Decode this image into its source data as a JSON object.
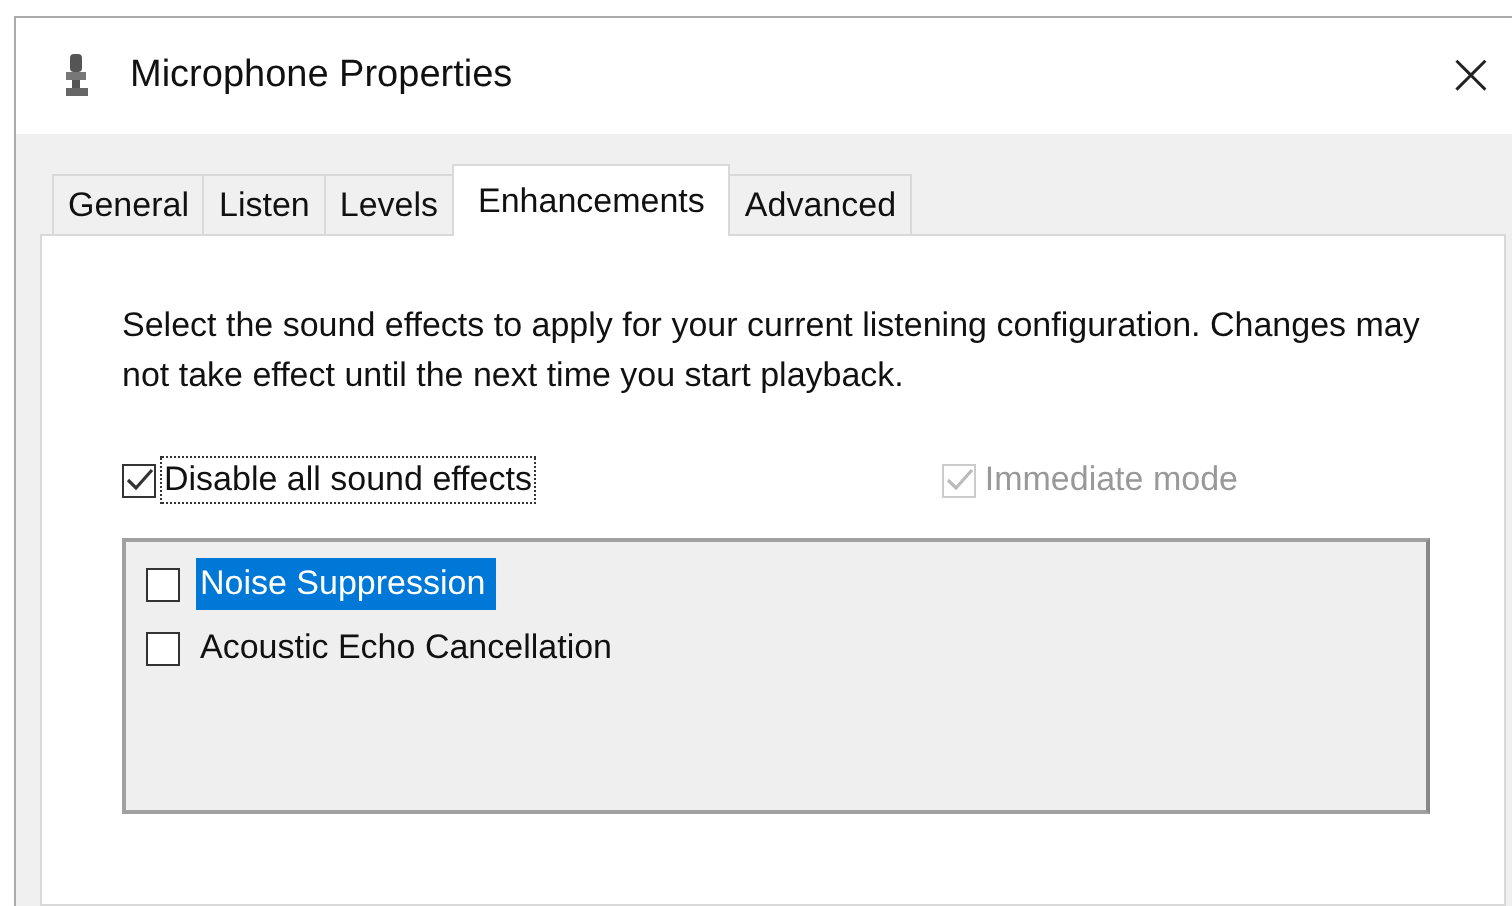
{
  "window": {
    "title": "Microphone Properties",
    "close": "×"
  },
  "tabs": [
    {
      "label": "General",
      "selected": false
    },
    {
      "label": "Listen",
      "selected": false
    },
    {
      "label": "Levels",
      "selected": false
    },
    {
      "label": "Enhancements",
      "selected": true
    },
    {
      "label": "Advanced",
      "selected": false
    }
  ],
  "description": "Select the sound effects to apply for your current listening configuration. Changes may not take effect until the next time you start playback.",
  "disable_all": {
    "label": "Disable all sound effects",
    "checked": true,
    "focused": true
  },
  "immediate_mode": {
    "label": "Immediate mode",
    "checked": true,
    "disabled": true
  },
  "effects": [
    {
      "label": "Noise Suppression",
      "checked": false,
      "selected": true
    },
    {
      "label": "Acoustic Echo Cancellation",
      "checked": false,
      "selected": false
    }
  ]
}
